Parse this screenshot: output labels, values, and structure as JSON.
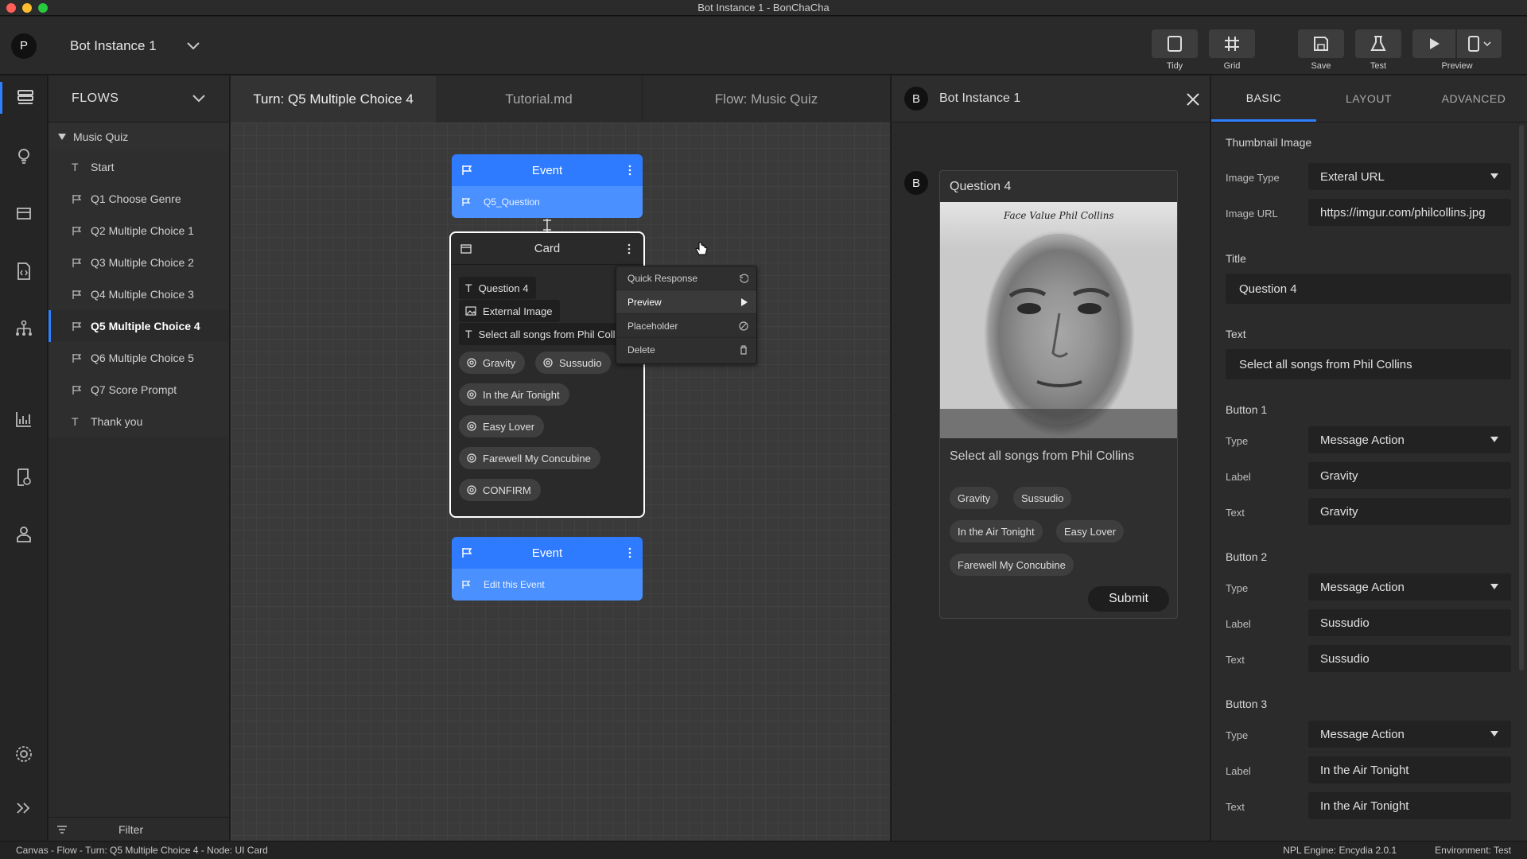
{
  "window_title": "Bot Instance 1 - BonChaCha",
  "header": {
    "avatar_letter": "P",
    "bot_name": "Bot Instance 1",
    "toolbar": {
      "tidy": "Tidy",
      "grid": "Grid",
      "save": "Save",
      "test": "Test",
      "preview": "Preview"
    }
  },
  "sidebar": {
    "title": "FLOWS",
    "root": "Music Quiz",
    "items": [
      {
        "label": "Start",
        "icon": "text-icon"
      },
      {
        "label": "Q1 Choose Genre",
        "icon": "flag-icon"
      },
      {
        "label": "Q2 Multiple Choice 1",
        "icon": "flag-icon"
      },
      {
        "label": "Q3 Multiple Choice 2",
        "icon": "flag-icon"
      },
      {
        "label": "Q4 Multiple Choice 3",
        "icon": "flag-icon"
      },
      {
        "label": "Q5 Multiple Choice 4",
        "icon": "flag-icon"
      },
      {
        "label": "Q6 Multiple Choice 5",
        "icon": "flag-icon"
      },
      {
        "label": "Q7 Score Prompt",
        "icon": "flag-icon"
      },
      {
        "label": "Thank you",
        "icon": "text-icon"
      }
    ],
    "active_item": "Q5 Multiple Choice 4",
    "filter": "Filter"
  },
  "tabs": [
    {
      "label": "Turn: Q5 Multiple Choice 4",
      "active": true
    },
    {
      "label": "Tutorial.md",
      "active": false
    },
    {
      "label": "Flow: Music Quiz",
      "active": false
    }
  ],
  "canvas": {
    "event1": {
      "title": "Event",
      "sub": "Q5_Question"
    },
    "card": {
      "title": "Card",
      "rows": [
        "Question 4",
        "External Image",
        "Select all songs from Phil Collins"
      ],
      "buttons": [
        "Gravity",
        "Sussudio",
        "In the Air Tonight",
        "Easy Lover",
        "Farewell My Concubine",
        "CONFIRM"
      ]
    },
    "event2": {
      "title": "Event",
      "sub": "Edit this Event"
    },
    "context_menu": [
      "Quick Response",
      "Preview",
      "Placeholder",
      "Delete"
    ]
  },
  "preview": {
    "title": "Bot Instance 1",
    "avatar_letter": "B",
    "card_title": "Question 4",
    "album_caption": "Face Value  Phil Collins",
    "text": "Select all songs from Phil Collins",
    "buttons": [
      "Gravity",
      "Sussudio",
      "In the Air Tonight",
      "Easy Lover",
      "Farewell My Concubine"
    ],
    "submit": "Submit"
  },
  "properties": {
    "tabs": [
      "BASIC",
      "LAYOUT",
      "ADVANCED"
    ],
    "thumbnail_section": "Thumbnail Image",
    "image_type_label": "Image Type",
    "image_type_value": "Exteral URL",
    "image_url_label": "Image URL",
    "image_url_value": "https://imgur.com/philcollins.jpg",
    "title_label": "Title",
    "title_value": "Question 4",
    "text_label": "Text",
    "text_value": "Select all songs from Phil Collins",
    "field_labels": {
      "type": "Type",
      "label": "Label",
      "text": "Text"
    },
    "buttons": [
      {
        "section": "Button 1",
        "type": "Message Action",
        "label": "Gravity",
        "text": "Gravity"
      },
      {
        "section": "Button 2",
        "type": "Message Action",
        "label": "Sussudio",
        "text": "Sussudio"
      },
      {
        "section": "Button 3",
        "type": "Message Action",
        "label": "In the Air Tonight",
        "text": "In the Air Tonight"
      }
    ]
  },
  "status": {
    "path": "Canvas - Flow - Turn: Q5 Multiple Choice 4 - Node: UI Card",
    "engine": "NPL Engine: Encydia 2.0.1",
    "environment": "Environment: Test"
  },
  "colors": {
    "accent": "#2f80ff",
    "event_blue": "#2f7bff",
    "background": "#2a2a2a"
  }
}
